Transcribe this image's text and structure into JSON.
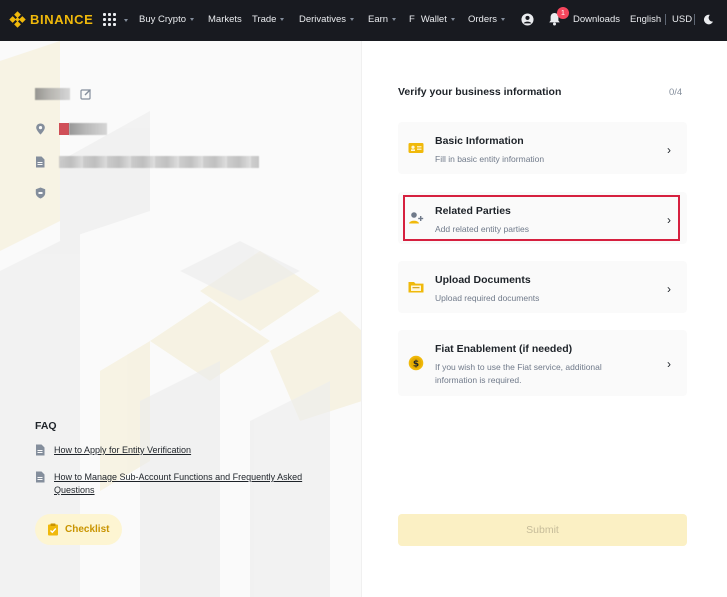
{
  "nav": {
    "brand": "BINANCE",
    "items": [
      {
        "label": "Buy Crypto",
        "caret": true
      },
      {
        "label": "Markets",
        "caret": false
      },
      {
        "label": "Trade",
        "caret": true
      },
      {
        "label": "Derivatives",
        "caret": true
      },
      {
        "label": "Earn",
        "caret": true
      },
      {
        "label": "Wallet",
        "caret": true
      },
      {
        "label": "Orders",
        "caret": true
      }
    ],
    "wallet_prefix": "F",
    "notification_count": "1",
    "downloads": "Downloads",
    "language": "English",
    "currency": "USD",
    "colors": {
      "bar": "#181a20",
      "brand": "#f0b90b",
      "badge": "#f6465d"
    }
  },
  "left": {
    "faq_title": "FAQ",
    "faq_links": [
      "How to Apply for Entity Verification",
      "How to Manage Sub-Account Functions and Frequently Asked Questions"
    ],
    "checklist_label": "Checklist"
  },
  "right": {
    "title": "Verify your business information",
    "progress": "0/4",
    "cards": [
      {
        "title": "Basic Information",
        "desc": "Fill in basic entity information",
        "icon": "id-card-icon"
      },
      {
        "title": "Related Parties",
        "desc": "Add related entity parties",
        "icon": "add-person-icon"
      },
      {
        "title": "Upload Documents",
        "desc": "Upload required documents",
        "icon": "folder-icon"
      },
      {
        "title": "Fiat Enablement (if needed)",
        "desc": "If you wish to use the Fiat service, additional information is required.",
        "icon": "coin-icon"
      }
    ],
    "submit_label": "Submit"
  }
}
